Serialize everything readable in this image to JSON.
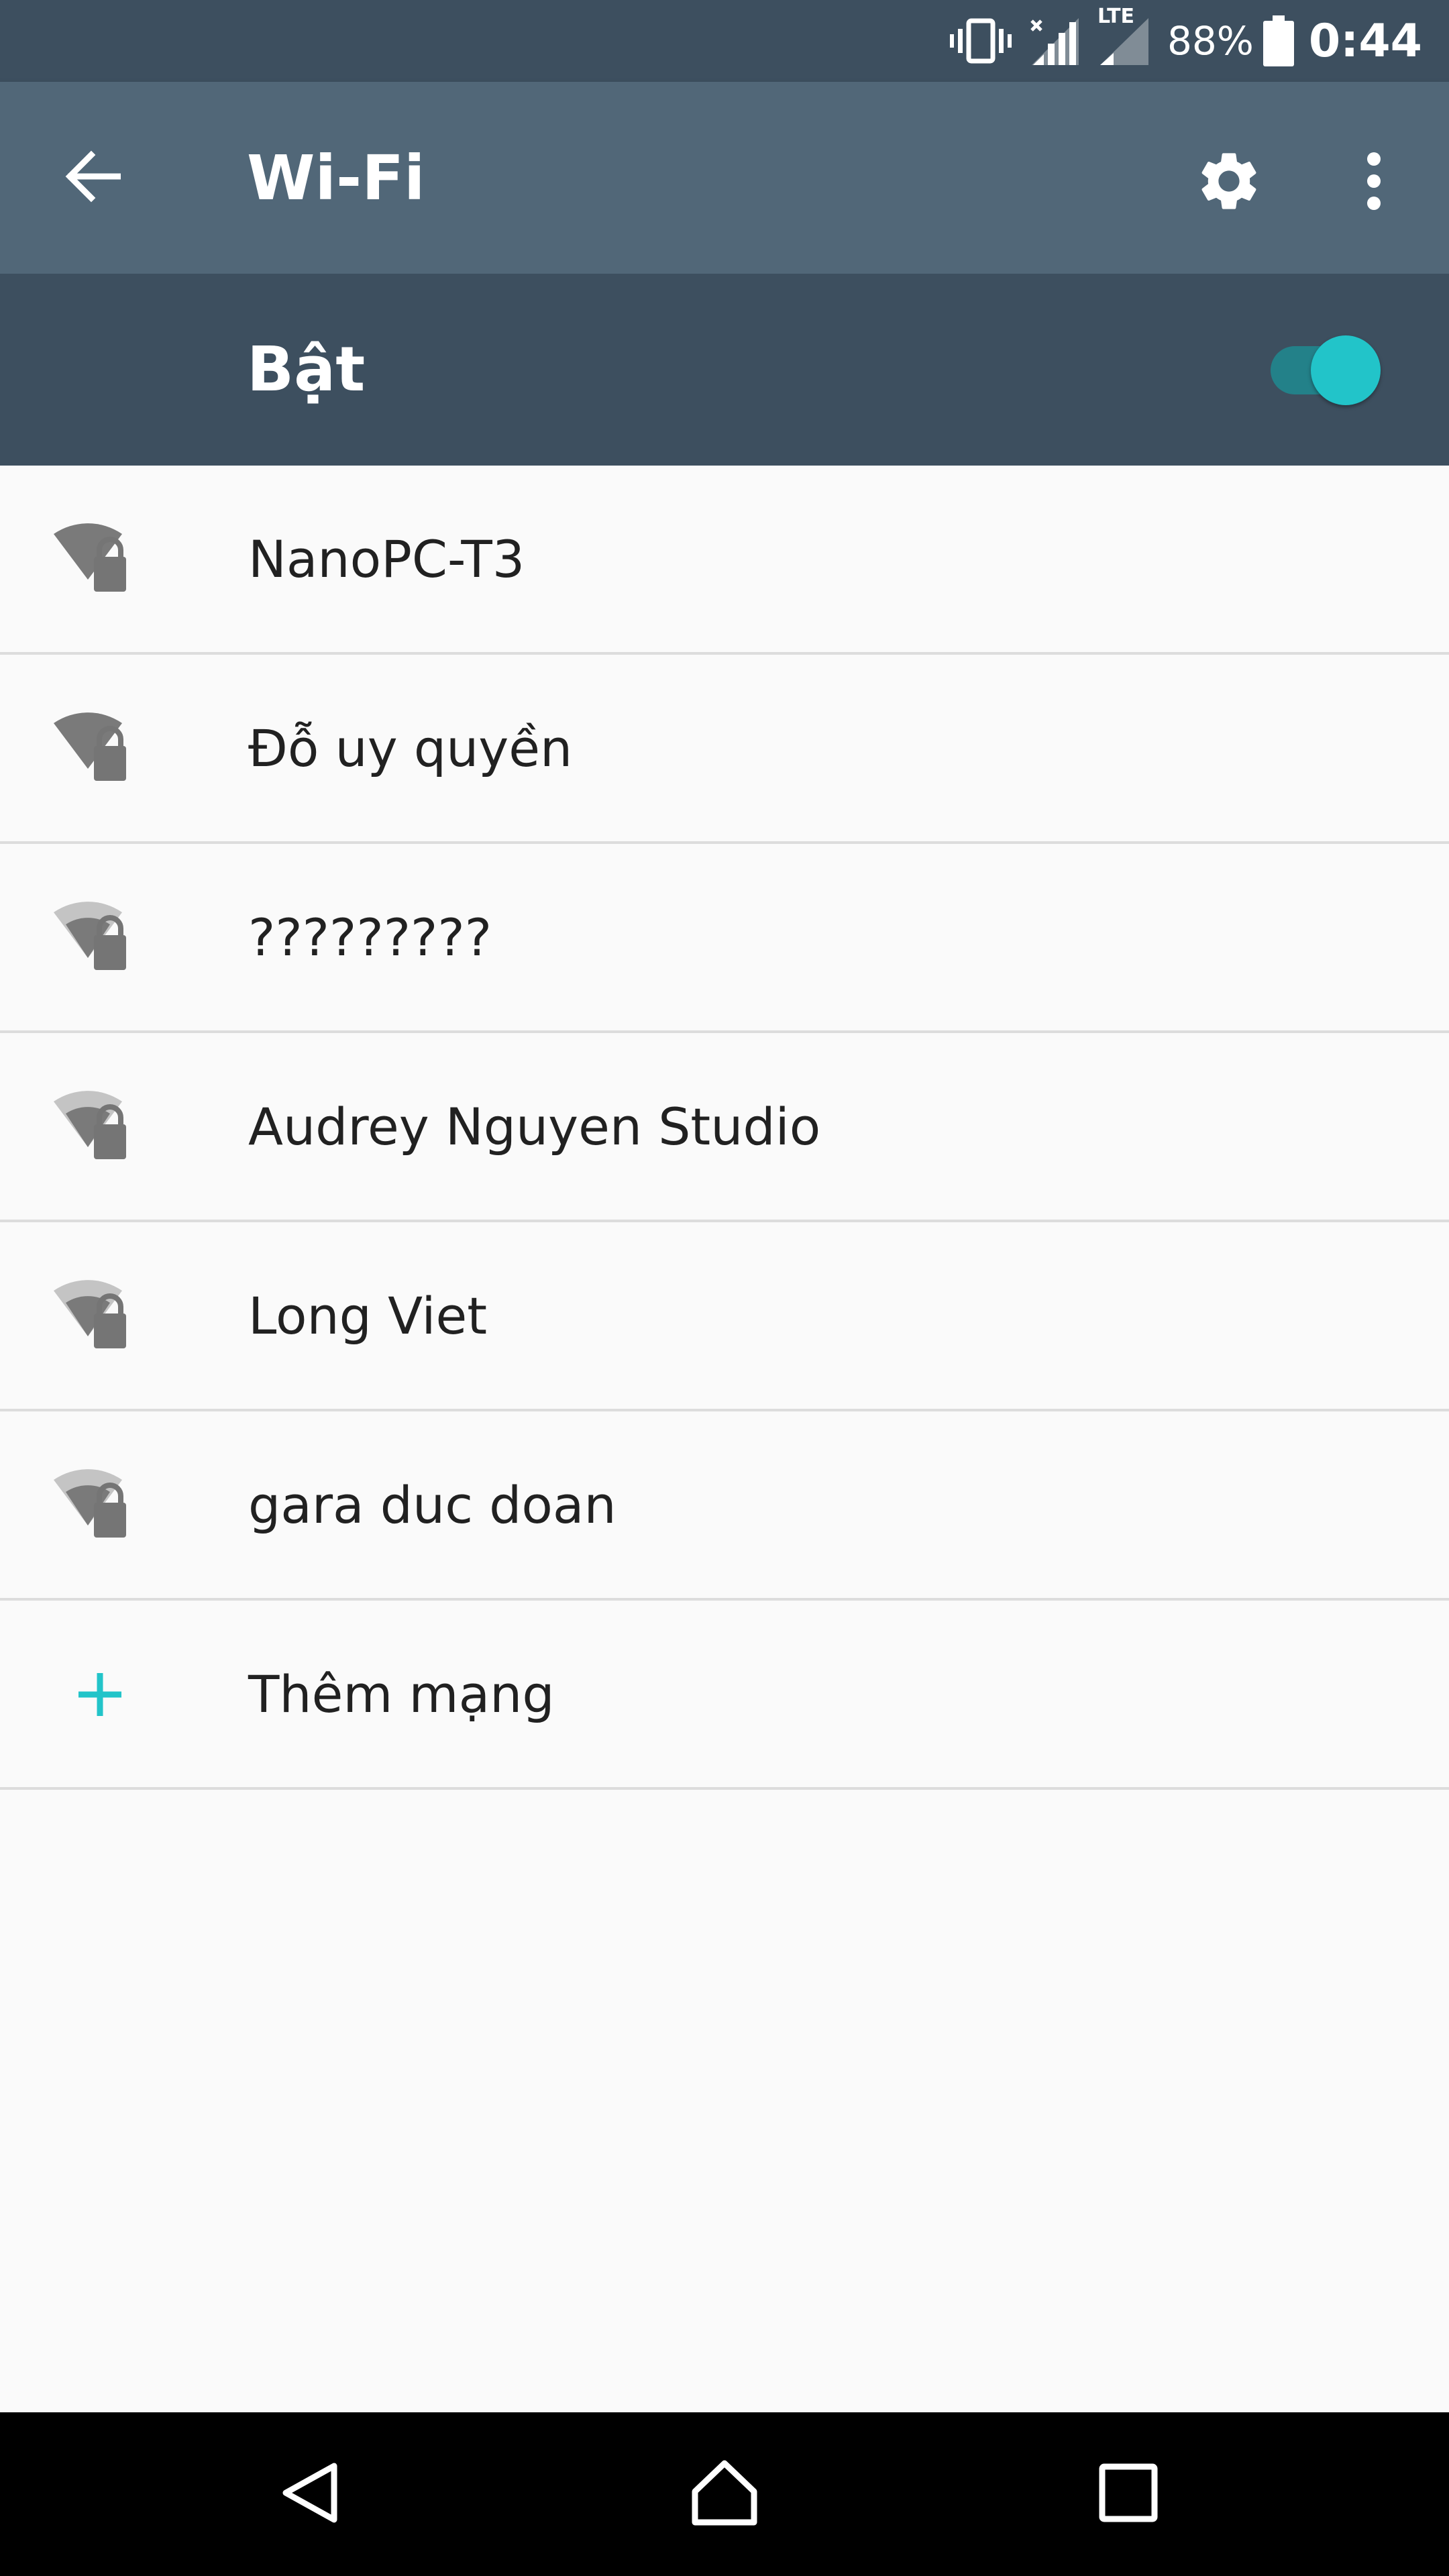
{
  "status_bar": {
    "battery": "88%",
    "clock": "0:44",
    "lte_label": "LTE",
    "icons": [
      "vibrate-icon",
      "signal-no-service-icon",
      "lte-signal-icon",
      "battery-icon"
    ]
  },
  "app_bar": {
    "title": "Wi-Fi",
    "icons": [
      "back-arrow-icon",
      "gear-icon",
      "more-vert-icon"
    ]
  },
  "wifi_toggle": {
    "label": "Bật",
    "state": "on",
    "accent_color": "#22c4c9"
  },
  "networks": [
    {
      "name": "NanoPC-T3",
      "icon": "wifi-lock-icon",
      "signal": "strong"
    },
    {
      "name": "Đỗ uy quyền",
      "icon": "wifi-lock-icon",
      "signal": "strong"
    },
    {
      "name": "?????????",
      "icon": "wifi-lock-icon",
      "signal": "medium"
    },
    {
      "name": "Audrey Nguyen Studio",
      "icon": "wifi-lock-icon",
      "signal": "medium"
    },
    {
      "name": "Long Viet",
      "icon": "wifi-lock-icon",
      "signal": "medium"
    },
    {
      "name": "gara duc doan",
      "icon": "wifi-lock-icon",
      "signal": "medium"
    }
  ],
  "add_network": {
    "label": "Thêm mạng",
    "icon": "plus-icon"
  },
  "nav_bar": {
    "icons": [
      "back-triangle-icon",
      "home-icon",
      "recents-icon"
    ]
  },
  "colors": {
    "status_bar": "#3d4f5f",
    "app_bar": "#516778",
    "toggle_bar": "#3d4f5f",
    "accent": "#22c4c9"
  }
}
